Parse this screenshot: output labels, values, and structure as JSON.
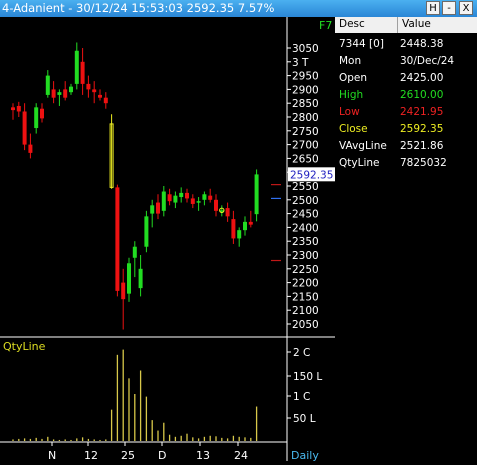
{
  "window": {
    "title": "4-Adanient - 30/12/24 15:53:03 2592.35 7.57%",
    "buttons": [
      "H",
      "-",
      "X"
    ]
  },
  "chart": {
    "hotkey": "F7",
    "price_axis_labels": [
      "3050",
      "3 T",
      "2950",
      "2900",
      "2850",
      "2800",
      "2750",
      "2700",
      "2650",
      "2600",
      "2550",
      "2500",
      "2450",
      "2400",
      "2350",
      "2300",
      "2250",
      "2200",
      "2150",
      "2100",
      "2050"
    ],
    "current_price_label": "2592.35",
    "volume_panel_label": "QtyLine",
    "volume_axis_labels": [
      "2 C",
      "150 L",
      "1 C",
      "50 L"
    ],
    "x_axis_labels": [
      "N",
      "12",
      "25",
      "D",
      "13",
      "24"
    ],
    "period": "Daily",
    "colors": {
      "up": "#22dd22",
      "down": "#ee1111",
      "doji": "#eeee22",
      "volume": "#d8c84a",
      "price_label_box": "#ffffff",
      "price_label_text": "#2020c0",
      "marker_red": "#c01818",
      "marker_blue": "#3070f0"
    }
  },
  "chart_data": {
    "type": "candlestick",
    "period": "Daily",
    "last_price": 2592.35,
    "price_axis_range": [
      2030,
      3080
    ],
    "volume_axis": [
      "50 L",
      "1 C",
      "150 L",
      "2 C"
    ],
    "candles": [
      {
        "o": 2835,
        "h": 2850,
        "l": 2790,
        "c": 2825
      },
      {
        "o": 2840,
        "h": 2855,
        "l": 2800,
        "c": 2820
      },
      {
        "o": 2820,
        "h": 2850,
        "l": 2680,
        "c": 2700
      },
      {
        "o": 2700,
        "h": 2740,
        "l": 2650,
        "c": 2670
      },
      {
        "o": 2760,
        "h": 2850,
        "l": 2740,
        "c": 2835
      },
      {
        "o": 2830,
        "h": 2850,
        "l": 2780,
        "c": 2795
      },
      {
        "o": 2880,
        "h": 2970,
        "l": 2870,
        "c": 2950
      },
      {
        "o": 2900,
        "h": 2930,
        "l": 2850,
        "c": 2870
      },
      {
        "o": 2880,
        "h": 2900,
        "l": 2840,
        "c": 2890
      },
      {
        "o": 2900,
        "h": 2930,
        "l": 2860,
        "c": 2870
      },
      {
        "o": 2890,
        "h": 2920,
        "l": 2880,
        "c": 2910
      },
      {
        "o": 2920,
        "h": 3070,
        "l": 2900,
        "c": 3040
      },
      {
        "o": 3000,
        "h": 3050,
        "l": 2880,
        "c": 2920
      },
      {
        "o": 2920,
        "h": 2950,
        "l": 2870,
        "c": 2900
      },
      {
        "o": 2900,
        "h": 2930,
        "l": 2850,
        "c": 2890
      },
      {
        "o": 2880,
        "h": 2900,
        "l": 2860,
        "c": 2870
      },
      {
        "o": 2870,
        "h": 2890,
        "l": 2830,
        "c": 2850
      },
      {
        "o": 2775,
        "h": 2810,
        "l": 2540,
        "c": 2545
      },
      {
        "o": 2545,
        "h": 2555,
        "l": 2150,
        "c": 2170
      },
      {
        "o": 2200,
        "h": 2250,
        "l": 2030,
        "c": 2140
      },
      {
        "o": 2160,
        "h": 2290,
        "l": 2130,
        "c": 2270
      },
      {
        "o": 2290,
        "h": 2350,
        "l": 2220,
        "c": 2330
      },
      {
        "o": 2180,
        "h": 2300,
        "l": 2150,
        "c": 2250
      },
      {
        "o": 2330,
        "h": 2460,
        "l": 2310,
        "c": 2440
      },
      {
        "o": 2450,
        "h": 2500,
        "l": 2400,
        "c": 2480
      },
      {
        "o": 2490,
        "h": 2520,
        "l": 2430,
        "c": 2450
      },
      {
        "o": 2460,
        "h": 2550,
        "l": 2440,
        "c": 2530
      },
      {
        "o": 2520,
        "h": 2540,
        "l": 2480,
        "c": 2495
      },
      {
        "o": 2490,
        "h": 2530,
        "l": 2470,
        "c": 2515
      },
      {
        "o": 2510,
        "h": 2545,
        "l": 2490,
        "c": 2525
      },
      {
        "o": 2525,
        "h": 2540,
        "l": 2490,
        "c": 2505
      },
      {
        "o": 2505,
        "h": 2520,
        "l": 2470,
        "c": 2485
      },
      {
        "o": 2490,
        "h": 2510,
        "l": 2460,
        "c": 2495
      },
      {
        "o": 2500,
        "h": 2530,
        "l": 2480,
        "c": 2520
      },
      {
        "o": 2515,
        "h": 2540,
        "l": 2490,
        "c": 2500
      },
      {
        "o": 2500,
        "h": 2520,
        "l": 2440,
        "c": 2460
      },
      {
        "o": 2460,
        "h": 2480,
        "l": 2440,
        "c": 2462
      },
      {
        "o": 2470,
        "h": 2490,
        "l": 2420,
        "c": 2440
      },
      {
        "o": 2430,
        "h": 2460,
        "l": 2340,
        "c": 2360
      },
      {
        "o": 2360,
        "h": 2400,
        "l": 2330,
        "c": 2390
      },
      {
        "o": 2390,
        "h": 2440,
        "l": 2370,
        "c": 2420
      },
      {
        "o": 2420,
        "h": 2460,
        "l": 2400,
        "c": 2410
      },
      {
        "o": 2448,
        "h": 2610,
        "l": 2422,
        "c": 2592
      }
    ],
    "volume": [
      3,
      4,
      5,
      4,
      6,
      4,
      8,
      3,
      2,
      3,
      2,
      5,
      7,
      4,
      3,
      2,
      3,
      60,
      165,
      175,
      120,
      90,
      135,
      85,
      40,
      20,
      35,
      12,
      8,
      10,
      14,
      7,
      5,
      8,
      10,
      9,
      6,
      5,
      10,
      8,
      7,
      6,
      66
    ]
  },
  "panel": {
    "headers": [
      "Desc",
      "Value"
    ],
    "rows": [
      {
        "desc": "7344 [0]",
        "value": "2448.38",
        "color": "#ffffff"
      },
      {
        "desc": "Mon",
        "value": "30/Dec/24",
        "color": "#ffffff"
      },
      {
        "desc": "Open",
        "value": "2425.00",
        "color": "#ffffff"
      },
      {
        "desc": "High",
        "value": "2610.00",
        "color": "#22dd22"
      },
      {
        "desc": "Low",
        "value": "2421.95",
        "color": "#ee2222"
      },
      {
        "desc": "Close",
        "value": "2592.35",
        "color": "#eeee22"
      },
      {
        "desc": "VAvgLine",
        "value": "2521.86",
        "color": "#ffffff"
      },
      {
        "desc": "QtyLine",
        "value": "7825032",
        "color": "#ffffff"
      }
    ]
  }
}
